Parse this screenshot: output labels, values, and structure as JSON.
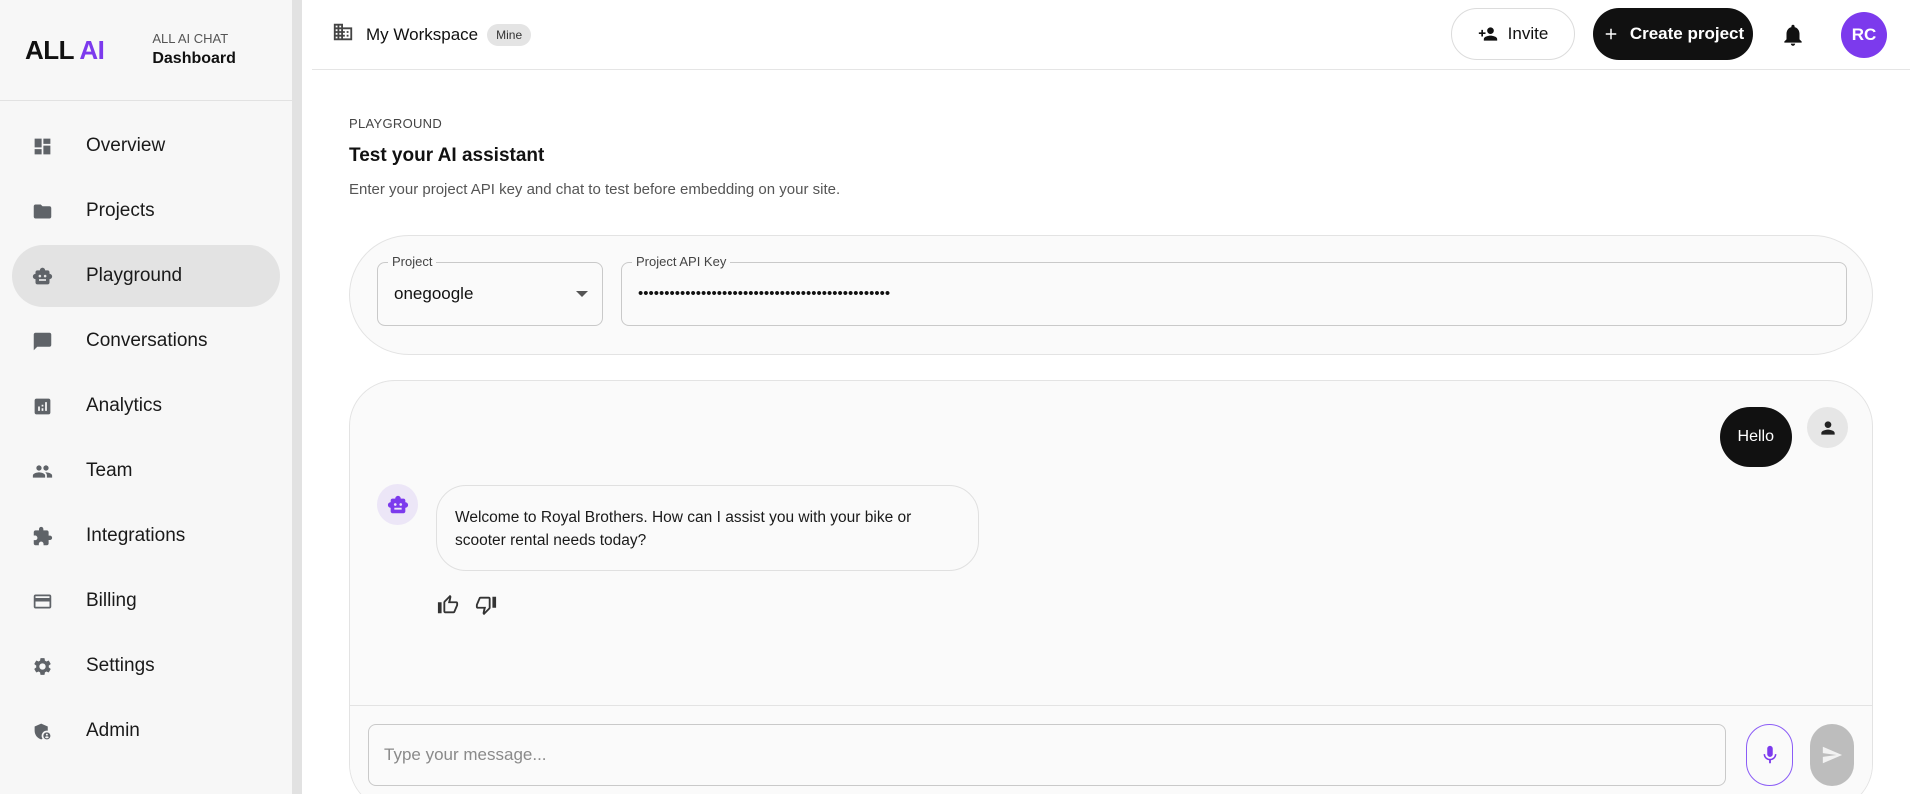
{
  "brand": {
    "logo_main": "ALL",
    "logo_accent": "AI",
    "subtitle": "ALL AI CHAT",
    "title": "Dashboard"
  },
  "sidebar": {
    "items": [
      {
        "label": "Overview",
        "icon": "dashboard-icon",
        "active": false
      },
      {
        "label": "Projects",
        "icon": "folder-icon",
        "active": false
      },
      {
        "label": "Playground",
        "icon": "robot-icon",
        "active": true
      },
      {
        "label": "Conversations",
        "icon": "chat-icon",
        "active": false
      },
      {
        "label": "Analytics",
        "icon": "analytics-icon",
        "active": false
      },
      {
        "label": "Team",
        "icon": "people-icon",
        "active": false
      },
      {
        "label": "Integrations",
        "icon": "puzzle-icon",
        "active": false
      },
      {
        "label": "Billing",
        "icon": "credit-card-icon",
        "active": false
      },
      {
        "label": "Settings",
        "icon": "gear-icon",
        "active": false
      },
      {
        "label": "Admin",
        "icon": "admin-shield-icon",
        "active": false
      }
    ]
  },
  "header": {
    "workspace_name": "My Workspace",
    "workspace_badge": "Mine",
    "invite_label": "Invite",
    "create_label": "Create project",
    "avatar_initials": "RC"
  },
  "page": {
    "eyebrow": "PLAYGROUND",
    "title": "Test your AI assistant",
    "description": "Enter your project API key and chat to test before embedding on your site."
  },
  "config": {
    "project_label": "Project",
    "project_value": "onegoogle",
    "api_key_label": "Project API Key",
    "api_key_value": "••••••••••••••••••••••••••••••••••••••••••••••••"
  },
  "chat": {
    "messages": [
      {
        "role": "user",
        "text": "Hello"
      },
      {
        "role": "assistant",
        "text": "Welcome to Royal Brothers. How can I assist you with your bike or scooter rental needs today?"
      }
    ],
    "input_placeholder": "Type your message..."
  },
  "colors": {
    "accent": "#7c3aed",
    "dark": "#111111",
    "sidebar_bg": "#f7f7f7"
  }
}
